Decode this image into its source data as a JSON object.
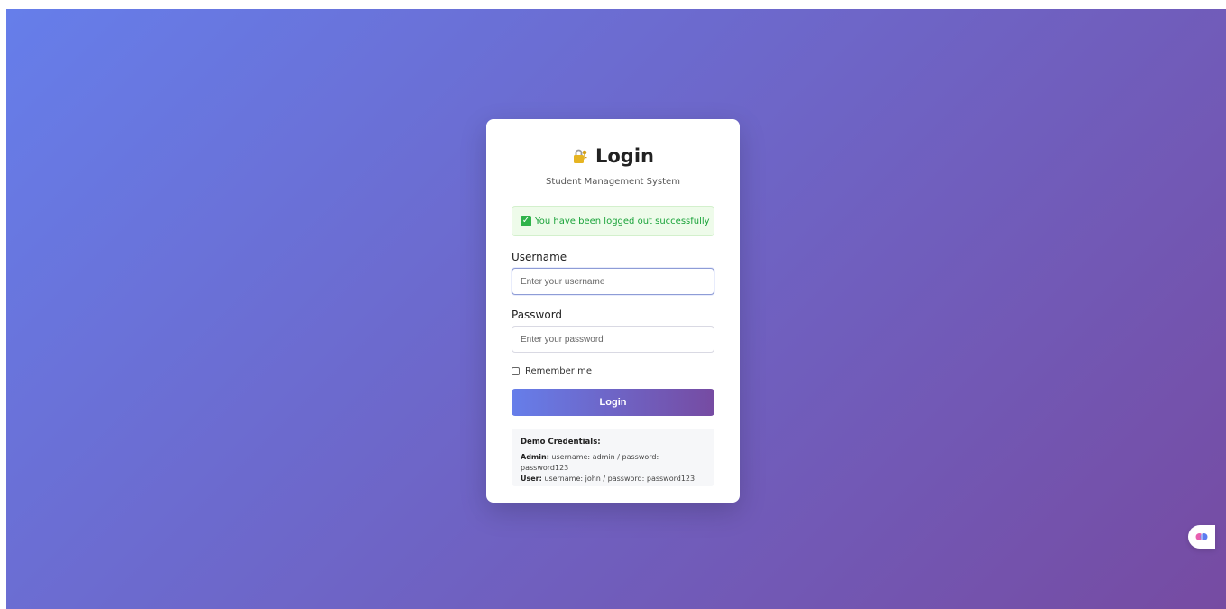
{
  "header": {
    "title": "Login",
    "subtitle": "Student Management System"
  },
  "alert": {
    "message": "You have been logged out successfully"
  },
  "form": {
    "username_label": "Username",
    "username_placeholder": "Enter your username",
    "password_label": "Password",
    "password_placeholder": "Enter your password",
    "remember_label": "Remember me",
    "submit_label": "Login"
  },
  "demo": {
    "title": "Demo Credentials:",
    "admin_prefix": "Admin:",
    "admin_text": " username: admin / password: password123",
    "user_prefix": "User:",
    "user_text": " username: john / password: password123"
  },
  "icons": {
    "title_icon": "lock-key-icon",
    "alert_icon": "check-icon",
    "widget_icon": "brain-icon"
  },
  "colors": {
    "gradient_start": "#667eea",
    "gradient_end": "#764ba2",
    "success_text": "#1aa33a",
    "success_bg": "#eefbea"
  }
}
